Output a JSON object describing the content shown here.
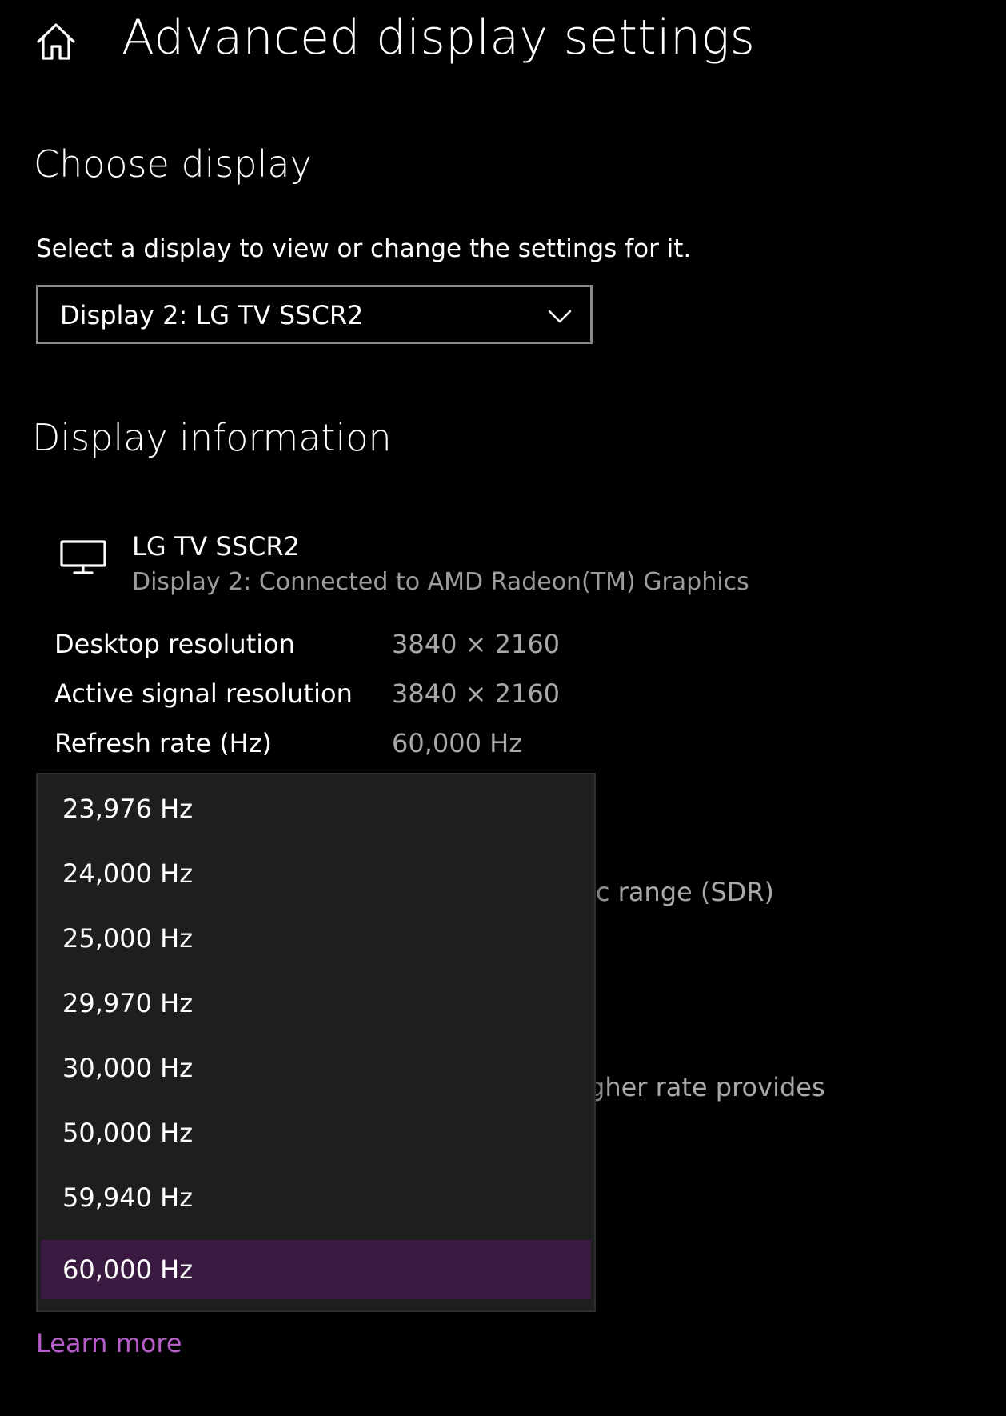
{
  "header": {
    "title": "Advanced display settings",
    "home_icon": "home-icon"
  },
  "choose_display": {
    "heading": "Choose display",
    "description": "Select a display to view or change the settings for it.",
    "selected_display": "Display 2: LG TV SSCR2"
  },
  "display_information": {
    "heading": "Display information",
    "monitor_icon": "monitor-icon",
    "display_name": "LG TV SSCR2",
    "connection": "Display 2: Connected to AMD Radeon(TM) Graphics",
    "rows": [
      {
        "label": "Desktop resolution",
        "value": "3840 × 2160"
      },
      {
        "label": "Active signal resolution",
        "value": "3840 × 2160"
      },
      {
        "label": "Refresh rate (Hz)",
        "value": "60,000 Hz"
      }
    ],
    "obscured_text_1": "ic range (SDR)",
    "obscured_text_2": "gher rate provides"
  },
  "refresh_rate_dropdown": {
    "options": [
      "23,976 Hz",
      "24,000 Hz",
      "25,000 Hz",
      "29,970 Hz",
      "30,000 Hz",
      "50,000 Hz",
      "59,940 Hz",
      "60,000 Hz"
    ],
    "selected": "60,000 Hz"
  },
  "learn_more": "Learn more",
  "colors": {
    "background": "#000000",
    "dropdown_bg": "#1e1e1e",
    "selected_option": "#3b1a42",
    "link_accent": "#b75dc9",
    "secondary_text": "#a8a8a8"
  }
}
